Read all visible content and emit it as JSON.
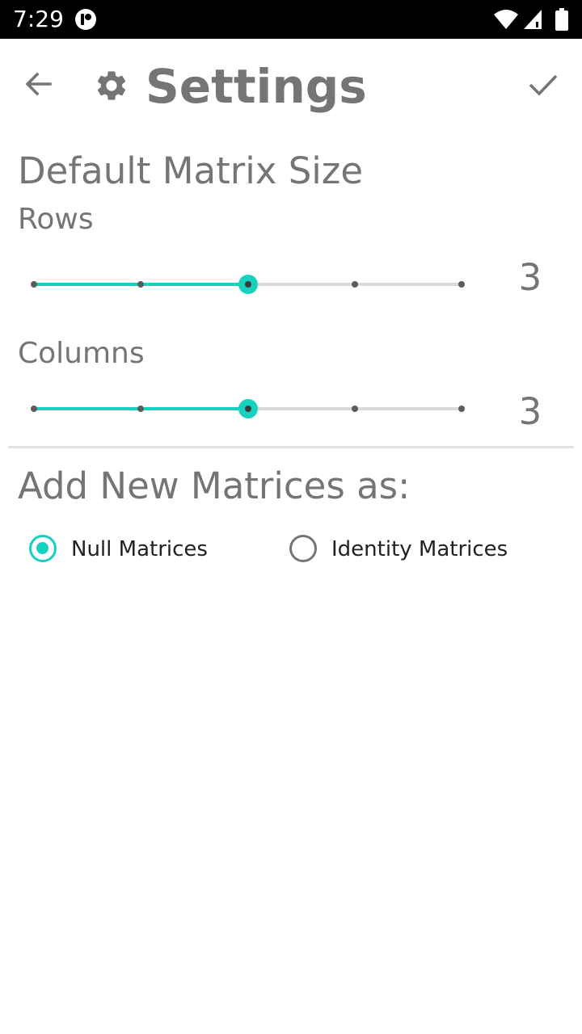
{
  "status_bar": {
    "time": "7:29",
    "icons": [
      "app-notification-icon",
      "wifi-icon",
      "cell-signal-icon",
      "battery-icon"
    ]
  },
  "toolbar": {
    "title": "Settings",
    "back_icon": "arrow-left-icon",
    "title_icon": "gear-icon",
    "confirm_icon": "check-icon"
  },
  "matrix_size": {
    "section_title": "Default Matrix Size",
    "rows": {
      "label": "Rows",
      "value": "3",
      "steps": 5,
      "selected_index": 2
    },
    "columns": {
      "label": "Columns",
      "value": "3",
      "steps": 5,
      "selected_index": 2
    }
  },
  "new_matrices": {
    "section_title": "Add New Matrices as:",
    "options": [
      {
        "label": "Null Matrices",
        "checked": true
      },
      {
        "label": "Identity Matrices",
        "checked": false
      }
    ]
  },
  "colors": {
    "accent": "#17d1c0",
    "text_secondary": "#757575",
    "text_primary": "#212121",
    "status_bar": "#000000"
  }
}
